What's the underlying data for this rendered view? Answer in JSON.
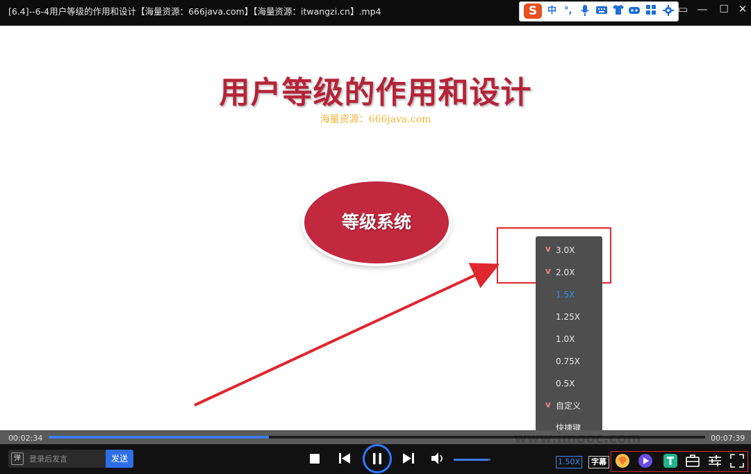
{
  "window": {
    "title": "[6.4]--6-4用户等级的作用和设计【海量资源：666java.com】【海量资源：itwangzi.cn】.mp4",
    "minimize_glyph": "—",
    "maximize_glyph": "☐",
    "close_glyph": "✕",
    "pin_glyph": "▭"
  },
  "ime_toolbar": {
    "logo": "S",
    "mode": "中",
    "punct": "°,",
    "icons": [
      "mic-icon",
      "keyboard-icon",
      "shirt-icon",
      "gamepad-icon",
      "apps-icon",
      "settings-icon"
    ]
  },
  "slide": {
    "title": "用户等级的作用和设计",
    "watermark": "海量资源：666java.com",
    "ellipse_text": "等级系统"
  },
  "speed_menu": {
    "items": [
      {
        "label": "3.0X",
        "vip": true,
        "active": false
      },
      {
        "label": "2.0X",
        "vip": true,
        "active": false
      },
      {
        "label": "1.5X",
        "vip": false,
        "active": true
      },
      {
        "label": "1.25X",
        "vip": false,
        "active": false
      },
      {
        "label": "1.0X",
        "vip": false,
        "active": false
      },
      {
        "label": "0.75X",
        "vip": false,
        "active": false
      },
      {
        "label": "0.5X",
        "vip": false,
        "active": false
      },
      {
        "label": "自定义",
        "vip": true,
        "active": false
      },
      {
        "label": "快捷键",
        "vip": false,
        "active": false
      }
    ],
    "vip_glyph": "V"
  },
  "progress": {
    "current_time": "00:02:34",
    "total_time": "00:07:39",
    "played_fraction": 0.335,
    "site_watermark": "www.imooc.com"
  },
  "controls": {
    "danmu_icon": "弹",
    "danmu_placeholder": "登录后发言",
    "send_label": "发送",
    "volume_fraction": 0.95,
    "speed_label": "1.50X",
    "subtitle_label": "字幕"
  },
  "colors": {
    "accent": "#3a8bf0",
    "highlight_red": "#e0262e",
    "slide_red": "#b52338"
  }
}
